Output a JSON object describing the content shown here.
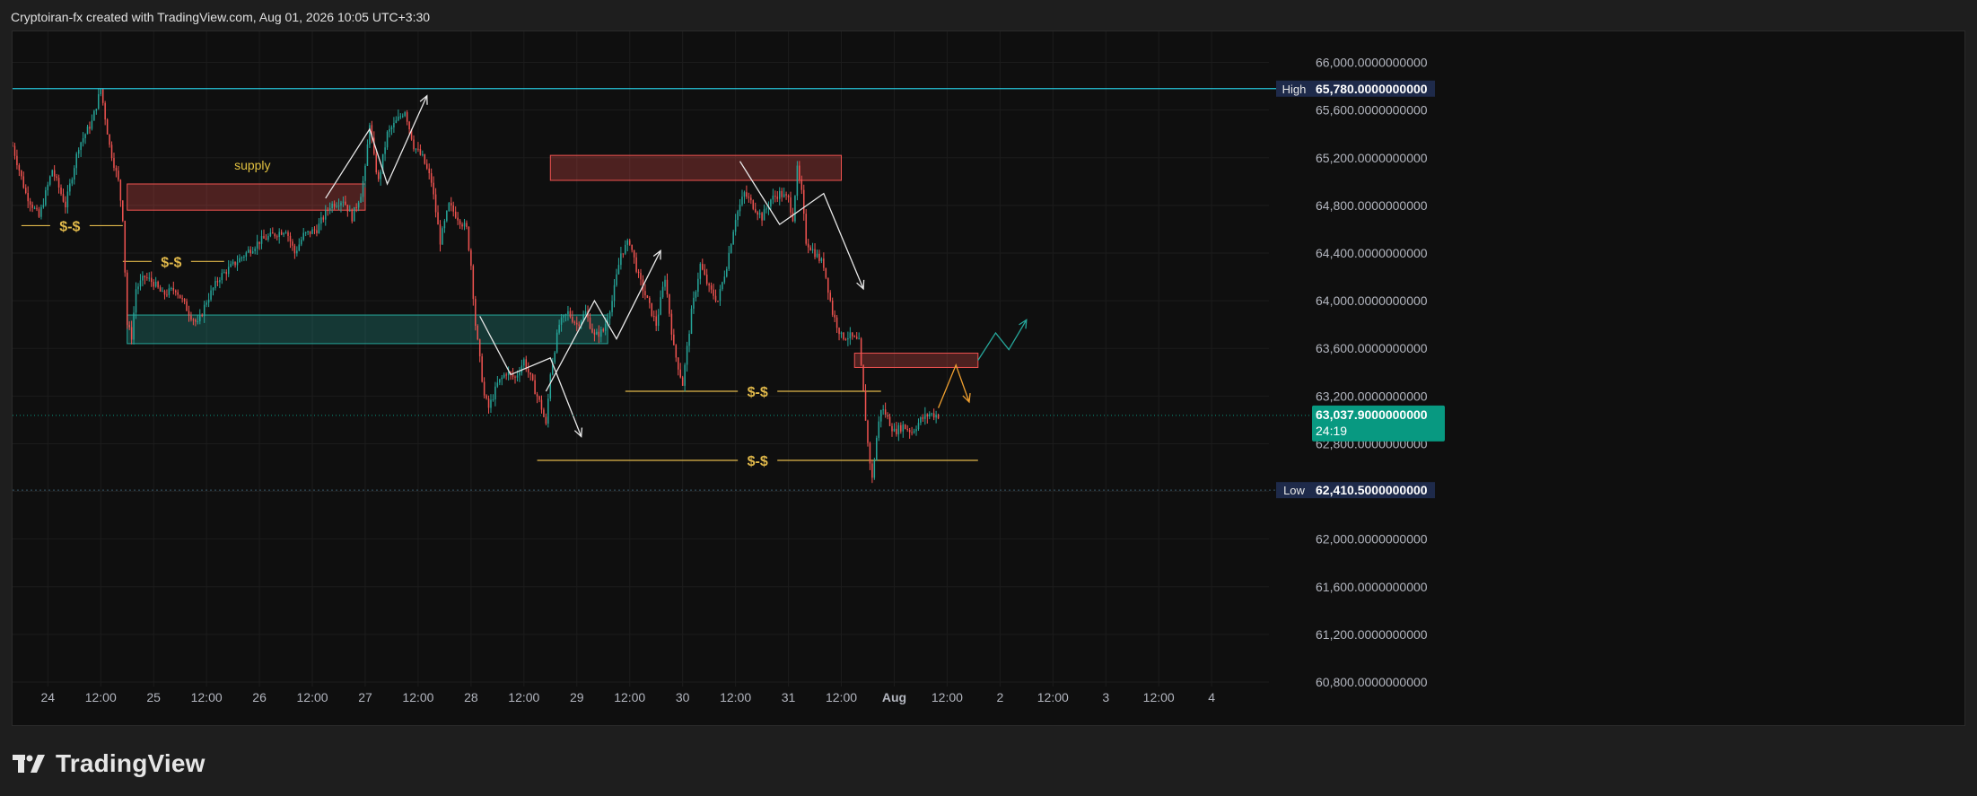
{
  "header": {
    "text": "Cryptoiran-fx created with TradingView.com, Aug 01, 2026 10:05 UTC+3:30"
  },
  "footer": {
    "brand": "TradingView"
  },
  "colors": {
    "bull": "#26a69a",
    "bear": "#ef5350",
    "bg": "#0f0f0f",
    "grid": "#1c1c1c",
    "high_line": "#26c6da",
    "badge_dark": "#1e2a4a",
    "badge_current": "#089981",
    "liquidity": "#e0b84a",
    "supply_zone": "#ef5350",
    "demand_zone": "#26a69a"
  },
  "chart_data": {
    "type": "candlestick",
    "y_range": [
      60800,
      66200
    ],
    "y_ticks": [
      "66,000.0000000000",
      "65,600.0000000000",
      "65,200.0000000000",
      "64,800.0000000000",
      "64,400.0000000000",
      "64,000.0000000000",
      "63,600.0000000000",
      "63,200.0000000000",
      "62,800.0000000000",
      "62,400.0000000000",
      "62,000.0000000000",
      "61,600.0000000000",
      "61,200.0000000000",
      "60,800.0000000000"
    ],
    "y_tick_values": [
      66000,
      65600,
      65200,
      64800,
      64400,
      64000,
      63600,
      63200,
      62800,
      62400,
      62000,
      61600,
      61200,
      60800
    ],
    "x_labels": [
      "24",
      "12:00",
      "25",
      "12:00",
      "26",
      "12:00",
      "27",
      "12:00",
      "28",
      "12:00",
      "29",
      "12:00",
      "30",
      "12:00",
      "31",
      "12:00",
      "Aug",
      "12:00",
      "2",
      "12:00",
      "3",
      "12:00",
      "4"
    ],
    "x_label_hours": [
      0,
      12,
      24,
      36,
      48,
      60,
      72,
      84,
      96,
      108,
      120,
      132,
      144,
      156,
      168,
      180,
      192,
      204,
      216,
      228,
      240,
      252,
      264
    ],
    "x_range_hours": [
      -8,
      277
    ],
    "high": {
      "label": "High",
      "value": "65,780.0000000000",
      "price": 65780
    },
    "low": {
      "label": "Low",
      "value": "62,410.5000000000",
      "price": 62410.5
    },
    "current": {
      "value": "63,037.9000000000",
      "countdown": "24:19",
      "price": 63037.9
    },
    "price_path": [
      [
        -8,
        65300
      ],
      [
        -5,
        64900
      ],
      [
        -2,
        64700
      ],
      [
        1,
        65100
      ],
      [
        4,
        64800
      ],
      [
        7,
        65300
      ],
      [
        10,
        65500
      ],
      [
        12,
        65780
      ],
      [
        14,
        65300
      ],
      [
        16,
        65000
      ],
      [
        17,
        64700
      ],
      [
        18,
        63800
      ],
      [
        19,
        63700
      ],
      [
        20,
        64100
      ],
      [
        22,
        64200
      ],
      [
        24,
        64150
      ],
      [
        26,
        64050
      ],
      [
        29,
        64100
      ],
      [
        32,
        63900
      ],
      [
        34,
        63800
      ],
      [
        36,
        64000
      ],
      [
        39,
        64200
      ],
      [
        42,
        64300
      ],
      [
        45,
        64400
      ],
      [
        48,
        64500
      ],
      [
        51,
        64550
      ],
      [
        54,
        64600
      ],
      [
        56,
        64400
      ],
      [
        58,
        64550
      ],
      [
        61,
        64600
      ],
      [
        64,
        64800
      ],
      [
        67,
        64850
      ],
      [
        69,
        64700
      ],
      [
        71,
        64900
      ],
      [
        72,
        65100
      ],
      [
        73,
        65500
      ],
      [
        74,
        65200
      ],
      [
        75,
        65000
      ],
      [
        77,
        65400
      ],
      [
        79,
        65500
      ],
      [
        81,
        65600
      ],
      [
        83,
        65300
      ],
      [
        85,
        65200
      ],
      [
        87,
        65000
      ],
      [
        89,
        64500
      ],
      [
        91,
        64800
      ],
      [
        93,
        64700
      ],
      [
        95,
        64600
      ],
      [
        96,
        64300
      ],
      [
        97,
        63800
      ],
      [
        98,
        63500
      ],
      [
        99,
        63200
      ],
      [
        100,
        63100
      ],
      [
        102,
        63300
      ],
      [
        104,
        63400
      ],
      [
        106,
        63350
      ],
      [
        108,
        63500
      ],
      [
        110,
        63300
      ],
      [
        112,
        63100
      ],
      [
        113,
        62950
      ],
      [
        114,
        63400
      ],
      [
        116,
        63800
      ],
      [
        118,
        63900
      ],
      [
        120,
        63800
      ],
      [
        122,
        63900
      ],
      [
        124,
        63700
      ],
      [
        126,
        63750
      ],
      [
        128,
        64000
      ],
      [
        130,
        64400
      ],
      [
        132,
        64500
      ],
      [
        134,
        64200
      ],
      [
        136,
        64000
      ],
      [
        138,
        63800
      ],
      [
        140,
        64200
      ],
      [
        142,
        63600
      ],
      [
        144,
        63300
      ],
      [
        146,
        63900
      ],
      [
        148,
        64300
      ],
      [
        150,
        64100
      ],
      [
        152,
        64000
      ],
      [
        154,
        64300
      ],
      [
        156,
        64700
      ],
      [
        158,
        64900
      ],
      [
        160,
        64800
      ],
      [
        162,
        64700
      ],
      [
        164,
        64850
      ],
      [
        166,
        64900
      ],
      [
        168,
        64850
      ],
      [
        169,
        64700
      ],
      [
        170,
        65100
      ],
      [
        171,
        64900
      ],
      [
        172,
        64500
      ],
      [
        174,
        64400
      ],
      [
        176,
        64300
      ],
      [
        178,
        63900
      ],
      [
        180,
        63700
      ],
      [
        182,
        63700
      ],
      [
        184,
        63650
      ],
      [
        186,
        62800
      ],
      [
        187,
        62500
      ],
      [
        188,
        62850
      ],
      [
        189,
        63100
      ],
      [
        190,
        63050
      ],
      [
        192,
        62900
      ],
      [
        194,
        62950
      ],
      [
        196,
        62900
      ],
      [
        198,
        63000
      ],
      [
        200,
        63050
      ],
      [
        202,
        63037.9
      ]
    ],
    "zones": [
      {
        "name": "supply",
        "label": "supply",
        "t0": 18,
        "t1": 72,
        "p0": 64760,
        "p1": 64980
      },
      {
        "name": "demand",
        "label": "",
        "t0": 18,
        "t1": 127,
        "p0": 63640,
        "p1": 63880
      },
      {
        "name": "supply-upper",
        "label": "",
        "t0": 114,
        "t1": 180,
        "p0": 65010,
        "p1": 65220
      },
      {
        "name": "supply-right",
        "label": "",
        "t0": 183,
        "t1": 211,
        "p0": 63440,
        "p1": 63560
      }
    ],
    "liquidity_levels": [
      {
        "label": "$-$",
        "t0": -6,
        "t1": 17,
        "price": 64630,
        "label_t": 5
      },
      {
        "label": "$-$",
        "t0": 17,
        "t1": 40,
        "price": 64330,
        "label_t": 28
      },
      {
        "label": "$-$",
        "t0": 131,
        "t1": 189,
        "price": 63240,
        "label_t": 161
      },
      {
        "label": "$-$",
        "t0": 111,
        "t1": 211,
        "price": 62660,
        "label_t": 161
      }
    ]
  }
}
